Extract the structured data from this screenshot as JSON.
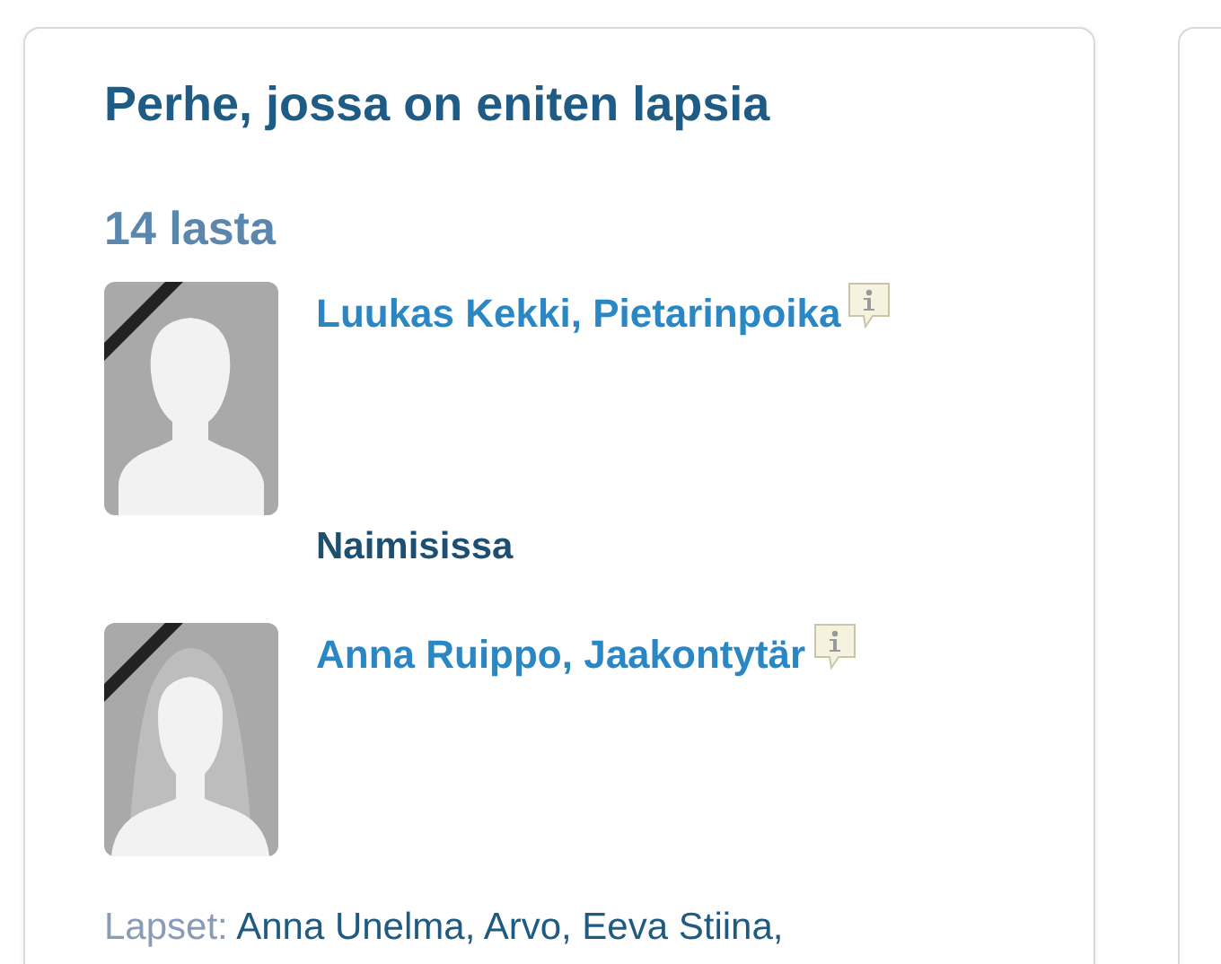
{
  "card": {
    "title": "Perhe, jossa on eniten lapsia",
    "count": "14 lasta",
    "persons": [
      {
        "name": "Luukas Kekki, Pietarinpoika",
        "kind": "male",
        "deceased": true
      },
      {
        "name": "Anna Ruippo, Jaakontytär",
        "kind": "female",
        "deceased": true
      }
    ],
    "relation": "Naimisissa",
    "children_label": "Lapset:",
    "children": "Anna Unelma, Arvo, Eeva Stiina,"
  }
}
